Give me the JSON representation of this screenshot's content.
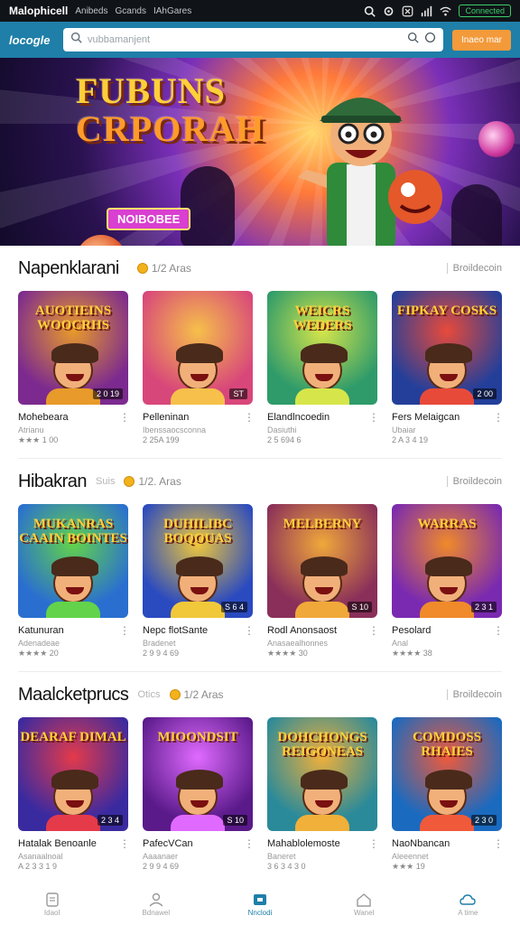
{
  "status_bar": {
    "title": "Malophicell",
    "crumbs": [
      "Anibeds",
      "Gcands",
      "IAhGares"
    ],
    "status_pill": "Connected"
  },
  "topbar": {
    "logo": "locogle",
    "search_placeholder": "vubbamanjent",
    "cta_label": "Inaeo mar"
  },
  "hero": {
    "title_line1": "FUBUNS",
    "title_line2": "CRPORAH",
    "badge": "NOIBOBEE",
    "colors": {
      "accent": "#ffcf3a",
      "badge": "#d93fd0"
    }
  },
  "sections": [
    {
      "title": "Napenklarani",
      "sub": "",
      "meta": "1/2  Aras",
      "see_all": "Broildecoin",
      "games": [
        {
          "name": "Mohebeara",
          "sub": "Atrianu",
          "rating": "★★★ 1 00",
          "tag": "2 0 19",
          "caption": "AUOTIEINS WOOCRHS",
          "bg": "#7c2a8f",
          "bg2": "#e89a2a"
        },
        {
          "name": "Pelleninan",
          "sub": "Ibenssaocsconna",
          "rating": "2 25A 199",
          "tag": "ST",
          "caption": "",
          "bg": "#d8477a",
          "bg2": "#f6c04a"
        },
        {
          "name": "Elandlncoedin",
          "sub": "Dasiuthi",
          "rating": "2 5 694 6",
          "tag": "",
          "caption": "WEICRS WEDERS",
          "bg": "#2f9b6a",
          "bg2": "#d6e64a"
        },
        {
          "name": "Fers Melaigcan",
          "sub": "Ubaiar",
          "rating": "2 A 3 4 19",
          "tag": "2 00",
          "caption": "FIPKAY COSKS",
          "bg": "#243f9a",
          "bg2": "#e84a3a"
        }
      ]
    },
    {
      "title": "Hibakran",
      "sub": "Suis",
      "meta": "1/2.  Aras",
      "see_all": "Broildecoin",
      "games": [
        {
          "name": "Katunuran",
          "sub": "Adenadeae",
          "rating": "★★★★ 20",
          "tag": "",
          "caption": "MUKANRAS CAAIN BOINTES",
          "bg": "#2a6fd0",
          "bg2": "#62d34a"
        },
        {
          "name": "Nepc flotSante",
          "sub": "Bradenet",
          "rating": "2 9 9 4 69",
          "tag": "S 6 4",
          "caption": "DUHILIBC BOQOUAS",
          "bg": "#2a4ac0",
          "bg2": "#f0c83a"
        },
        {
          "name": "Rodl Anonsaost",
          "sub": "Anasaealhonnes",
          "rating": "★★★★ 30",
          "tag": "S 10",
          "caption": "MELBERNY",
          "bg": "#8a2f5a",
          "bg2": "#f0a83a"
        },
        {
          "name": "Pesolard",
          "sub": "Anal",
          "rating": "★★★★ 38",
          "tag": "2 3 1",
          "caption": "WARRAS",
          "bg": "#7a2ab0",
          "bg2": "#f08a2a"
        }
      ]
    },
    {
      "title": "Maalcketprucs",
      "sub": "Otics",
      "meta": "1/2  Aras",
      "see_all": "Broildecoin",
      "games": [
        {
          "name": "Hatalak Benoanle",
          "sub": "Asanaalnoal",
          "rating": "A 2 3 3 1 9",
          "tag": "2 3 4",
          "caption": "DEARAF DIMAL",
          "bg": "#3a2aa0",
          "bg2": "#e43a4a"
        },
        {
          "name": "PafecVCan",
          "sub": "Aaaanaer",
          "rating": "2 9 9 4 69",
          "tag": "S 10",
          "caption": "MIOONDSIT",
          "bg": "#5a1a8a",
          "bg2": "#e06aff"
        },
        {
          "name": "Mahablolemoste",
          "sub": "Baneret",
          "rating": "3 6 3 4 3 0",
          "tag": "",
          "caption": "DOHCHONGS REIGONEAS",
          "bg": "#2a8a9a",
          "bg2": "#f0b03a"
        },
        {
          "name": "NaoNbancan",
          "sub": "Aleeennet",
          "rating": "★★★ 19",
          "tag": "2 3 0",
          "caption": "COMDOSS RHAIES",
          "bg": "#1a6ac0",
          "bg2": "#f05a3a"
        }
      ]
    }
  ],
  "bottom_nav": [
    {
      "label": "Idaol",
      "icon": "document-icon",
      "active": false
    },
    {
      "label": "Bdnawel",
      "icon": "profile-icon",
      "active": false
    },
    {
      "label": "Nnclodi",
      "icon": "store-icon",
      "active": true
    },
    {
      "label": "Wanel",
      "icon": "home-icon",
      "active": false
    },
    {
      "label": "A time",
      "icon": "cloud-icon",
      "active": false
    }
  ]
}
